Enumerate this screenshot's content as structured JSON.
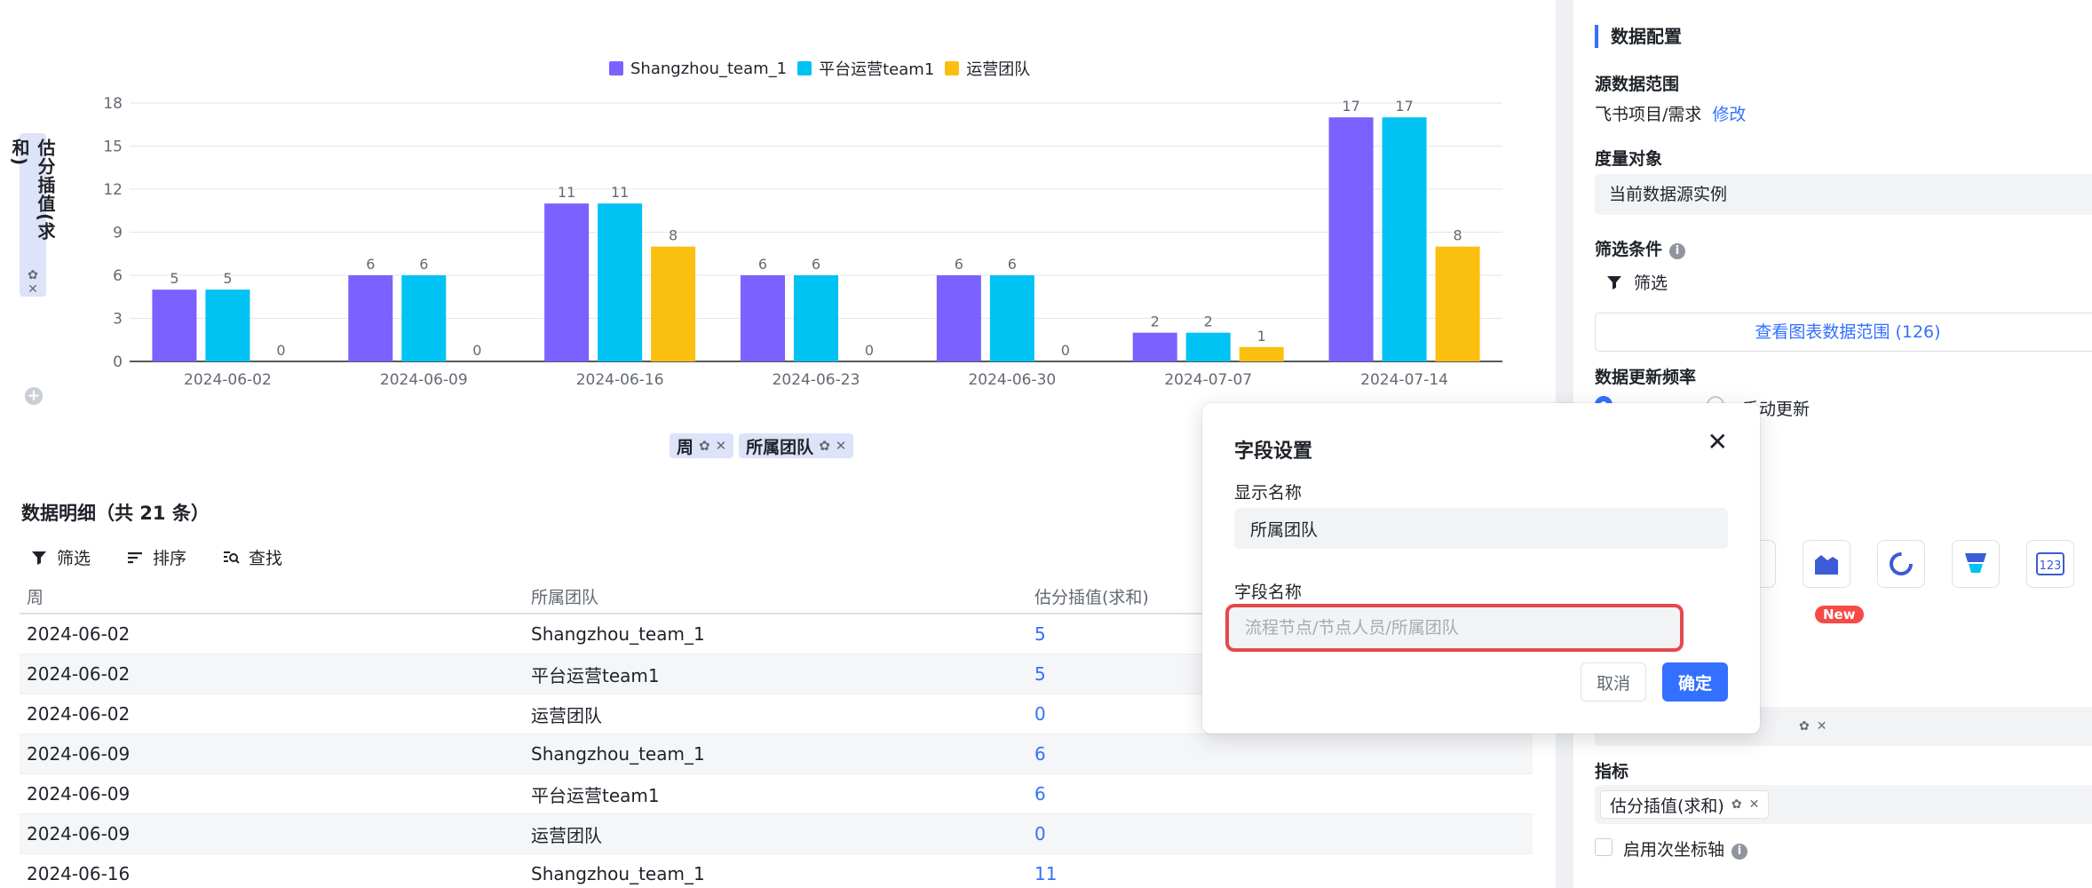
{
  "chart": {
    "y_field": {
      "label": "估分插值(求和)"
    },
    "x_fields": [
      {
        "label": "周"
      },
      {
        "label": "所属团队"
      }
    ],
    "colors": {
      "Shangzhou_team_1": "#7b61ff",
      "平台运营team1": "#00c2f3",
      "运营团队": "#fbbf0f"
    }
  },
  "chart_data": {
    "type": "bar",
    "categories": [
      "2024-06-02",
      "2024-06-09",
      "2024-06-16",
      "2024-06-23",
      "2024-06-30",
      "2024-07-07",
      "2024-07-14"
    ],
    "series": [
      {
        "name": "Shangzhou_team_1",
        "values": [
          5,
          6,
          11,
          6,
          6,
          2,
          17
        ]
      },
      {
        "name": "平台运营team1",
        "values": [
          5,
          6,
          11,
          6,
          6,
          2,
          17
        ]
      },
      {
        "name": "运营团队",
        "values": [
          0,
          0,
          8,
          0,
          0,
          1,
          8
        ]
      }
    ],
    "yticks": [
      "0",
      "3",
      "6",
      "9",
      "12",
      "15",
      "18"
    ],
    "ylim": [
      0,
      18
    ],
    "legend": "top-center",
    "grid": true
  },
  "detail": {
    "title": "数据明细（共 21 条）",
    "toolbar": {
      "filter": "筛选",
      "sort": "排序",
      "find": "查找"
    },
    "columns": [
      "周",
      "所属团队",
      "估分插值(求和)"
    ],
    "rows": [
      [
        "2024-06-02",
        "Shangzhou_team_1",
        "5"
      ],
      [
        "2024-06-02",
        "平台运营team1",
        "5"
      ],
      [
        "2024-06-02",
        "运营团队",
        "0"
      ],
      [
        "2024-06-09",
        "Shangzhou_team_1",
        "6"
      ],
      [
        "2024-06-09",
        "平台运营team1",
        "6"
      ],
      [
        "2024-06-09",
        "运营团队",
        "0"
      ],
      [
        "2024-06-16",
        "Shangzhou_team_1",
        "11"
      ]
    ]
  },
  "panel": {
    "title": "数据配置",
    "source_range_label": "源数据范围",
    "source_range_value": "飞书项目/需求",
    "modify_link": "修改",
    "measure_label": "度量对象",
    "measure_value": "当前数据源实例",
    "filter_label": "筛选条件",
    "filter_button": "筛选",
    "view_range_button": "查看图表数据范围 (126)",
    "update_freq_label": "数据更新频率",
    "update_manual": "手动更新",
    "new_badge": "New",
    "metric_label": "指标",
    "metric_chip": "估分插值(求和)",
    "secondary_axis_label": "启用次坐标轴"
  },
  "modal": {
    "title": "字段设置",
    "display_name_label": "显示名称",
    "display_name_value": "所属团队",
    "field_name_label": "字段名称",
    "field_name_placeholder": "流程节点/节点人员/所属团队",
    "cancel": "取消",
    "confirm": "确定"
  }
}
